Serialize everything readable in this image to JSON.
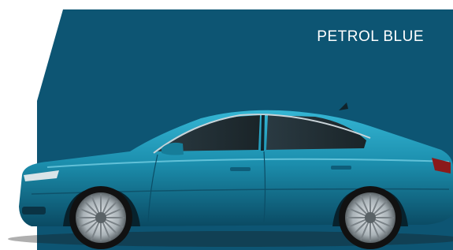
{
  "swatch": {
    "color_name": "PETROL BLUE",
    "panel_color": "#0d5573",
    "car_body_color": "#1c8fae",
    "text_color": "#ffffff"
  },
  "image": {
    "subject": "car-side-view"
  }
}
